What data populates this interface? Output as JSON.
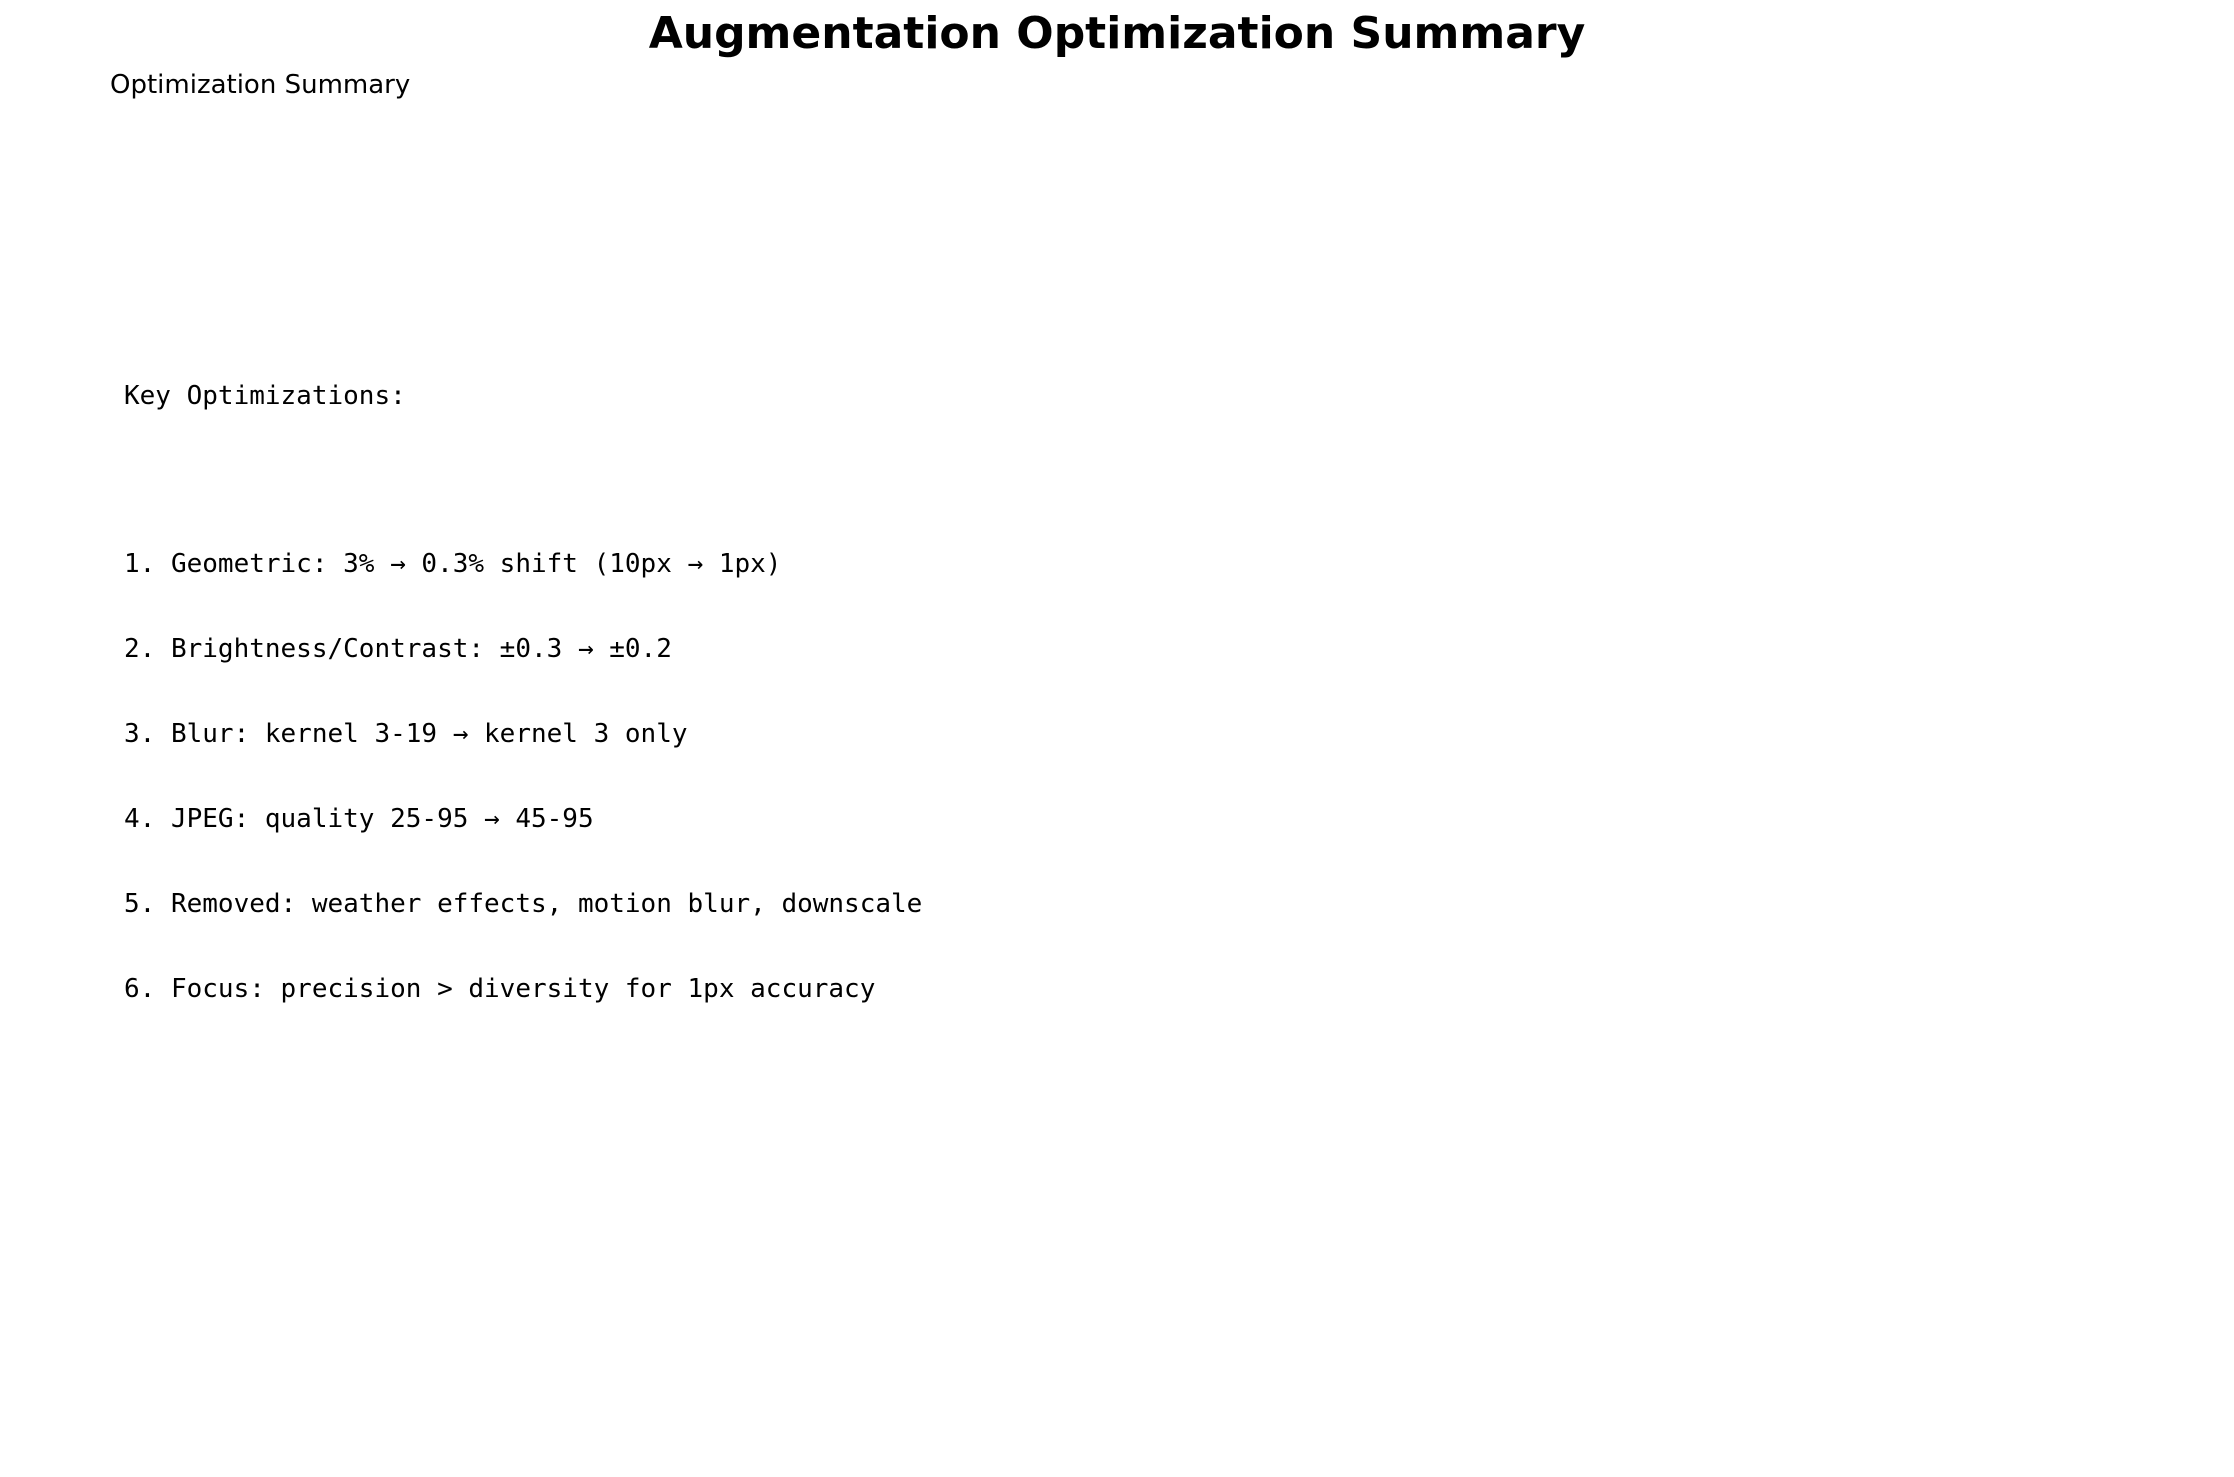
{
  "figure": {
    "title": "Augmentation Optimization Summary"
  },
  "panel": {
    "title": "Optimization Summary"
  },
  "summary": {
    "heading": "Key Optimizations:",
    "items": [
      "1. Geometric: 3% → 0.3% shift (10px → 1px)",
      "2. Brightness/Contrast: ±0.3 → ±0.2",
      "3. Blur: kernel 3-19 → kernel 3 only",
      "4. JPEG: quality 25-95 → 45-95",
      "5. Removed: weather effects, motion blur, downscale",
      "6. Focus: precision > diversity for 1px accuracy"
    ]
  }
}
